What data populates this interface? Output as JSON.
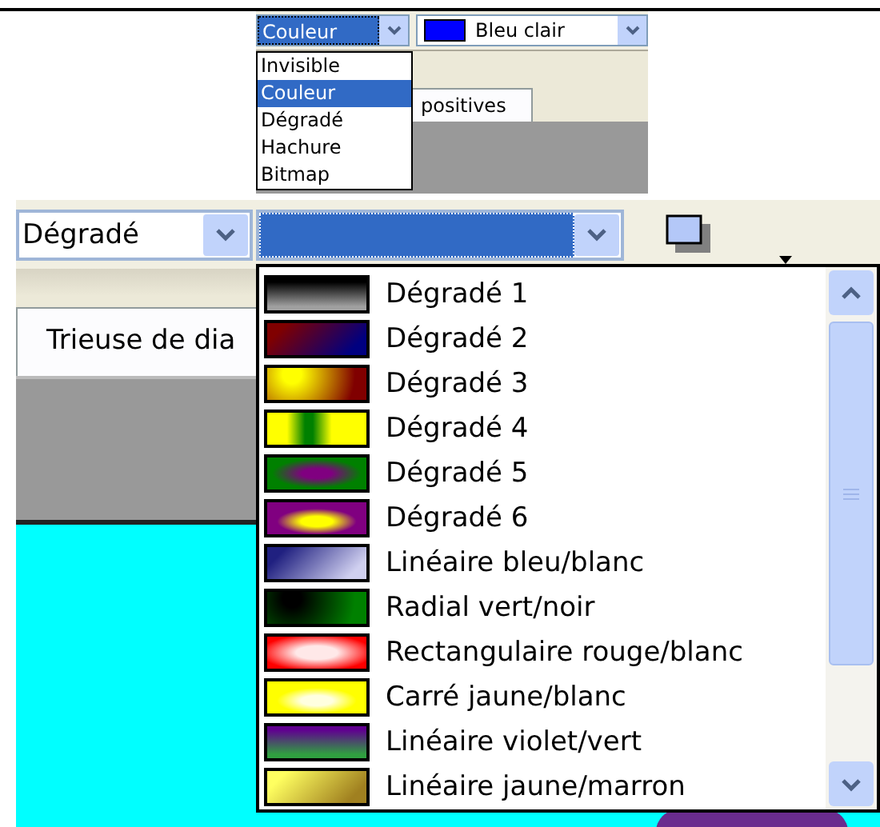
{
  "top_panel": {
    "fill_type_combo": {
      "value": "Couleur"
    },
    "color_combo": {
      "value": "Bleu clair",
      "color": "#0000ff"
    },
    "tab": {
      "label": "positives"
    },
    "fill_type_list": [
      {
        "label": "Invisible",
        "selected": false
      },
      {
        "label": "Couleur",
        "selected": true
      },
      {
        "label": "Dégradé",
        "selected": false
      },
      {
        "label": "Hachure",
        "selected": false
      },
      {
        "label": "Bitmap",
        "selected": false
      }
    ]
  },
  "bottom_panel": {
    "fill_type_combo": {
      "value": "Dégradé"
    },
    "tab": {
      "label": "Trieuse de dia"
    },
    "gradient_list": [
      {
        "label": "Dégradé 1",
        "kind": "vertical",
        "stops": [
          {
            "color": "#000000"
          },
          {
            "color": "#a0a0a0"
          }
        ]
      },
      {
        "label": "Dégradé 2",
        "kind": "diagonal",
        "stops": [
          {
            "color": "#800000"
          },
          {
            "color": "#000080"
          }
        ]
      },
      {
        "label": "Dégradé 3",
        "kind": "radial",
        "stops": [
          {
            "color": "#ffff00"
          },
          {
            "color": "#800000"
          }
        ]
      },
      {
        "label": "Dégradé 4",
        "kind": "axial",
        "stops": [
          {
            "color": "#008000"
          },
          {
            "color": "#ffff00"
          }
        ]
      },
      {
        "label": "Dégradé 5",
        "kind": "ellipse",
        "stops": [
          {
            "color": "#800080"
          },
          {
            "color": "#008000"
          }
        ]
      },
      {
        "label": "Dégradé 6",
        "kind": "square",
        "stops": [
          {
            "color": "#ffff00"
          },
          {
            "color": "#800080"
          }
        ]
      },
      {
        "label": "Linéaire bleu/blanc",
        "kind": "diagonal",
        "stops": [
          {
            "color": "#202080"
          },
          {
            "color": "#d0d0f0"
          }
        ]
      },
      {
        "label": "Radial vert/noir",
        "kind": "radial",
        "stops": [
          {
            "color": "#000000"
          },
          {
            "color": "#008000"
          }
        ]
      },
      {
        "label": "Rectangulaire rouge/blanc",
        "kind": "rectangle",
        "stops": [
          {
            "color": "#ffe8e8"
          },
          {
            "color": "#ff0000"
          }
        ]
      },
      {
        "label": "Carré jaune/blanc",
        "kind": "square",
        "stops": [
          {
            "color": "#ffffe0"
          },
          {
            "color": "#ffff00"
          }
        ]
      },
      {
        "label": "Linéaire violet/vert",
        "kind": "vertical",
        "stops": [
          {
            "color": "#600090"
          },
          {
            "color": "#30a040"
          }
        ]
      },
      {
        "label": "Linéaire jaune/marron",
        "kind": "diagonal",
        "stops": [
          {
            "color": "#ffff60"
          },
          {
            "color": "#a08020"
          }
        ]
      }
    ]
  }
}
